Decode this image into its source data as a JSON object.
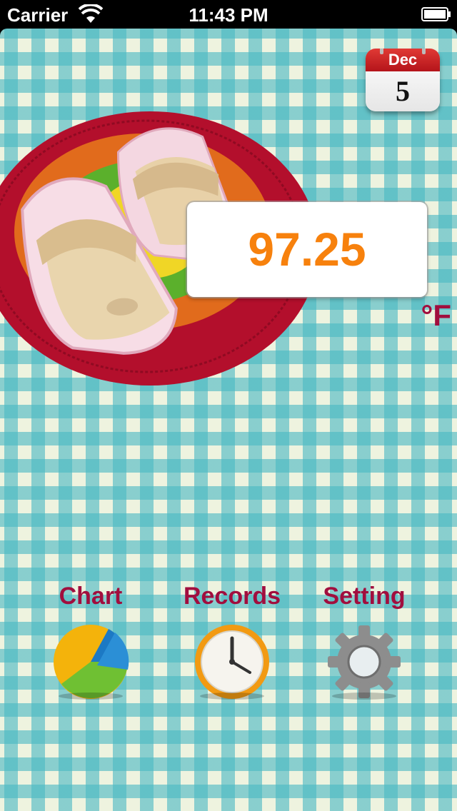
{
  "status_bar": {
    "carrier": "Carrier",
    "time": "11:43 PM",
    "wifi_icon": "wifi-icon",
    "battery_icon": "battery-icon"
  },
  "calendar": {
    "month": "Dec",
    "day": "5",
    "icon": "calendar-icon"
  },
  "reading": {
    "value": "97.25",
    "unit": "°F"
  },
  "nav": {
    "chart": {
      "label": "Chart",
      "icon": "pie-chart-icon"
    },
    "records": {
      "label": "Records",
      "icon": "clock-icon"
    },
    "setting": {
      "label": "Setting",
      "icon": "gear-icon"
    }
  },
  "colors": {
    "accent_text": "#a10e3e",
    "reading_value": "#f7810d",
    "gingham": "#4ab9c3"
  }
}
